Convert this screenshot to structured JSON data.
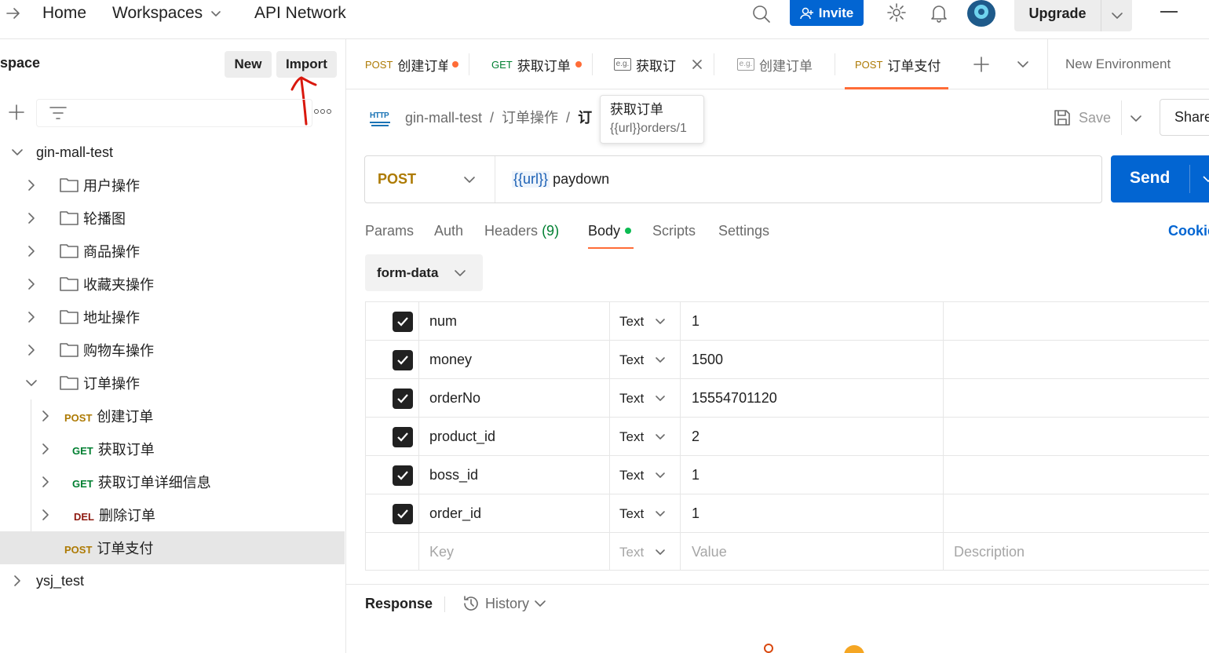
{
  "topbar": {
    "home": "Home",
    "workspaces": "Workspaces",
    "api_network": "API Network",
    "invite": "Invite",
    "upgrade": "Upgrade"
  },
  "sidebar": {
    "workspace_title": "space",
    "new_button": "New",
    "import_button": "Import",
    "tree": [
      {
        "label": "gin-mall-test"
      },
      {
        "label": "用户操作"
      },
      {
        "label": "轮播图"
      },
      {
        "label": "商品操作"
      },
      {
        "label": "收藏夹操作"
      },
      {
        "label": "地址操作"
      },
      {
        "label": "购物车操作"
      },
      {
        "label": "订单操作"
      },
      {
        "method": "POST",
        "label": "创建订单"
      },
      {
        "method": "GET",
        "label": "获取订单"
      },
      {
        "method": "GET",
        "label": "获取订单详细信息"
      },
      {
        "method": "DEL",
        "label": "删除订单"
      },
      {
        "method": "POST",
        "label": "订单支付"
      },
      {
        "label": "ysj_test"
      }
    ]
  },
  "tabs": [
    {
      "method": "POST",
      "label": "创建订单"
    },
    {
      "method": "GET",
      "label": "获取订单"
    },
    {
      "example": "e.g.",
      "label": "获取订"
    },
    {
      "example": "e.g.",
      "label": "创建订单"
    },
    {
      "method": "POST",
      "label": "订单支付"
    }
  ],
  "environment": "New Environment",
  "tooltip": {
    "title": "获取订单",
    "url": "{{url}}orders/1"
  },
  "breadcrumb": {
    "http_badge": "HTTP",
    "collection": "gin-mall-test",
    "separator": "/",
    "folder": "订单操作",
    "current": "订"
  },
  "actions": {
    "save": "Save",
    "share": "Share"
  },
  "request": {
    "method": "POST",
    "url_var": "{{url}}",
    "url_path": "paydown",
    "send": "Send"
  },
  "request_tabs": {
    "params": "Params",
    "auth": "Auth",
    "headers": "Headers",
    "headers_count": "(9)",
    "body": "Body",
    "scripts": "Scripts",
    "settings": "Settings",
    "cookies": "Cookies"
  },
  "body_mode": "form-data",
  "form_rows": [
    {
      "key": "num",
      "type": "Text",
      "value": "1"
    },
    {
      "key": "money",
      "type": "Text",
      "value": "1500"
    },
    {
      "key": "orderNo",
      "type": "Text",
      "value": "15554701120"
    },
    {
      "key": "product_id",
      "type": "Text",
      "value": "2"
    },
    {
      "key": "boss_id",
      "type": "Text",
      "value": "1"
    },
    {
      "key": "order_id",
      "type": "Text",
      "value": "1"
    }
  ],
  "form_placeholder": {
    "key": "Key",
    "type": "Text",
    "value": "Value",
    "description": "Description"
  },
  "response": {
    "title": "Response",
    "history": "History"
  },
  "colors": {
    "accent": "#ff6c37",
    "primary": "#0265d2",
    "post": "#ad7a03",
    "get": "#007f31",
    "del": "#8e1a10"
  }
}
